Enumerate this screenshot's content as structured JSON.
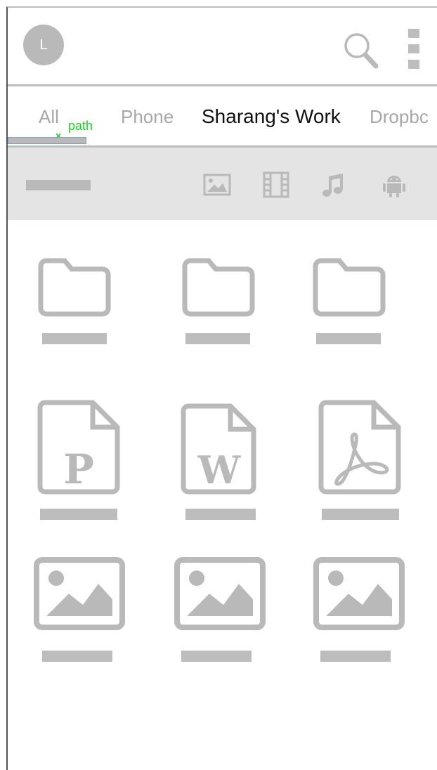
{
  "header": {
    "avatar_initial": "L",
    "search_icon": "search-icon",
    "menu_icon": "more-vert-icon"
  },
  "tabs": [
    {
      "label": "All",
      "selected": false
    },
    {
      "label": "Phone",
      "selected": false
    },
    {
      "label": "Sharang's Work",
      "selected": true
    },
    {
      "label": "Dropbc",
      "selected": false
    }
  ],
  "annotation": {
    "text": "path",
    "mark": "×"
  },
  "filters": {
    "icons": [
      "image-icon",
      "film-icon",
      "music-icon",
      "android-icon"
    ]
  },
  "files": {
    "rows": [
      [
        "folder-icon",
        "folder-icon",
        "folder-icon"
      ],
      [
        "powerpoint-file-icon",
        "word-file-icon",
        "pdf-file-icon"
      ],
      [
        "image-file-icon",
        "image-file-icon",
        "image-file-icon"
      ]
    ]
  },
  "colors": {
    "icon_gray": "#b9b9b9",
    "filter_bg": "#e4e4e4",
    "annotation_green": "#19d31e",
    "active_tab": "#111111",
    "inactive_tab": "#a7a7a7"
  }
}
